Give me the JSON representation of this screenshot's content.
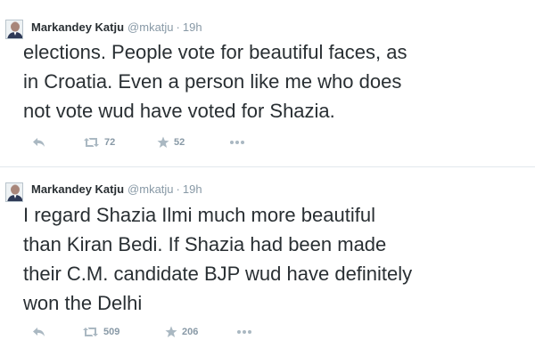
{
  "tweets": [
    {
      "author": {
        "name": "Markandey Katju",
        "handle": "@mkatju",
        "separator": "·",
        "time": "19h"
      },
      "text_lines": [
        "elections. People vote for beautiful faces, as",
        "in Croatia. Even a person like me who does",
        "not vote wud have voted for Shazia."
      ],
      "retweets": "72",
      "favorites": "52"
    },
    {
      "author": {
        "name": "Markandey Katju",
        "handle": "@mkatju",
        "separator": "·",
        "time": "19h"
      },
      "text_lines": [
        "I regard Shazia Ilmi much more beautiful",
        "than Kiran Bedi. If Shazia had been made",
        "their C.M. candidate BJP wud have definitely",
        "won the Delhi"
      ],
      "retweets": "509",
      "favorites": "206"
    }
  ],
  "icons": {
    "reply": "reply-arrow-icon",
    "retweet": "retweet-icon",
    "favorite": "star-icon",
    "more": "ellipsis-icon"
  },
  "colors": {
    "text": "#292f33",
    "muted": "#8899a6",
    "icon": "#aab8c2",
    "divider": "#e1e8ed"
  }
}
